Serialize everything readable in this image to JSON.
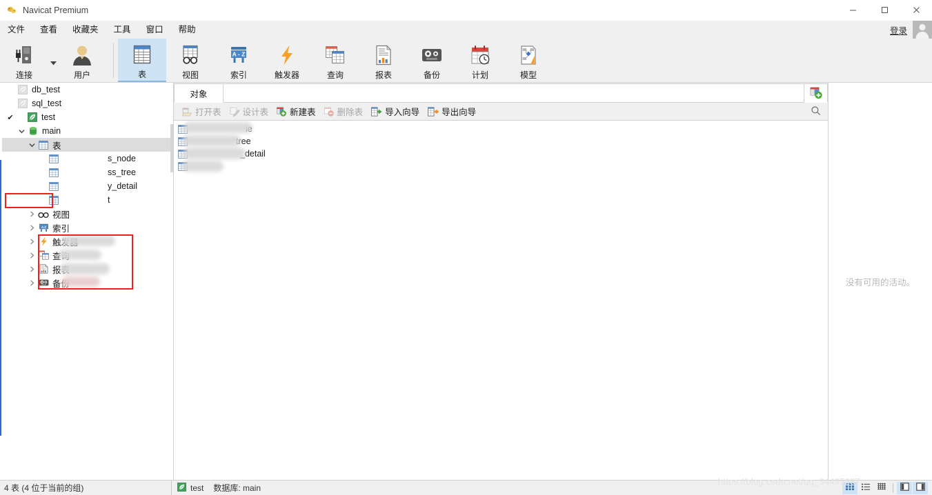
{
  "window": {
    "title": "Navicat Premium",
    "app_icon": "navicat-logo-icon",
    "minimize": "–",
    "maximize": "□",
    "close": "✕"
  },
  "menubar": {
    "items": [
      {
        "label": "文件",
        "name": "menu-file"
      },
      {
        "label": "查看",
        "name": "menu-view"
      },
      {
        "label": "收藏夹",
        "name": "menu-favorites"
      },
      {
        "label": "工具",
        "name": "menu-tools"
      },
      {
        "label": "窗口",
        "name": "menu-window"
      },
      {
        "label": "帮助",
        "name": "menu-help"
      }
    ],
    "login_label": "登录",
    "avatar_icon": "user-avatar-icon"
  },
  "ribbon": {
    "left": [
      {
        "label": "连接",
        "icon": "connection-icon",
        "active": false
      },
      {
        "label": "用户",
        "icon": "user-icon",
        "active": false
      }
    ],
    "right": [
      {
        "label": "表",
        "icon": "table-icon",
        "active": true
      },
      {
        "label": "视图",
        "icon": "view-glasses-icon",
        "active": false
      },
      {
        "label": "索引",
        "icon": "index-az-icon",
        "active": false
      },
      {
        "label": "触发器",
        "icon": "trigger-bolt-icon",
        "active": false
      },
      {
        "label": "查询",
        "icon": "query-icon",
        "active": false
      },
      {
        "label": "报表",
        "icon": "report-icon",
        "active": false
      },
      {
        "label": "备份",
        "icon": "backup-tape-icon",
        "active": false
      },
      {
        "label": "计划",
        "icon": "schedule-calendar-icon",
        "active": false
      },
      {
        "label": "模型",
        "icon": "model-diagram-icon",
        "active": false
      }
    ],
    "dropdown_caret": "▾"
  },
  "sidebar": {
    "items": [
      {
        "label": "db_test",
        "icon": "connection-leaf-icon",
        "indent": 0,
        "arrow": "",
        "checked": false,
        "selected": false,
        "state": "inactive"
      },
      {
        "label": "sql_test",
        "icon": "connection-leaf-icon",
        "indent": 0,
        "arrow": "",
        "checked": false,
        "selected": false,
        "state": "inactive"
      },
      {
        "label": "test",
        "icon": "connection-leaf-icon",
        "indent": 0,
        "arrow": "",
        "checked": true,
        "selected": false,
        "state": "active"
      },
      {
        "label": "main",
        "icon": "database-icon",
        "indent": 1,
        "arrow": "▾",
        "checked": false,
        "selected": false,
        "state": "active"
      },
      {
        "label": "表",
        "icon": "folder-table-icon",
        "indent": 2,
        "arrow": "▾",
        "checked": false,
        "selected": true,
        "state": "active"
      },
      {
        "label": "s_node",
        "icon": "table-item-icon",
        "indent": 3,
        "arrow": "",
        "checked": false,
        "selected": false,
        "state": "active",
        "redacted": true
      },
      {
        "label": "ss_tree",
        "icon": "table-item-icon",
        "indent": 3,
        "arrow": "",
        "checked": false,
        "selected": false,
        "state": "active",
        "redacted": true
      },
      {
        "label": "y_detail",
        "icon": "table-item-icon",
        "indent": 3,
        "arrow": "",
        "checked": false,
        "selected": false,
        "state": "active",
        "redacted": true
      },
      {
        "label": "t",
        "icon": "table-item-icon",
        "indent": 3,
        "arrow": "",
        "checked": false,
        "selected": false,
        "state": "active",
        "redacted": true
      },
      {
        "label": "视图",
        "icon": "view-glasses-icon",
        "indent": 2,
        "arrow": "›",
        "checked": false,
        "selected": false,
        "state": "active"
      },
      {
        "label": "索引",
        "icon": "index-az-icon",
        "indent": 2,
        "arrow": "›",
        "checked": false,
        "selected": false,
        "state": "active"
      },
      {
        "label": "触发器",
        "icon": "trigger-bolt-icon",
        "indent": 2,
        "arrow": "›",
        "checked": false,
        "selected": false,
        "state": "active"
      },
      {
        "label": "查询",
        "icon": "query-icon",
        "indent": 2,
        "arrow": "›",
        "checked": false,
        "selected": false,
        "state": "active"
      },
      {
        "label": "报表",
        "icon": "report-icon",
        "indent": 2,
        "arrow": "›",
        "checked": false,
        "selected": false,
        "state": "active"
      },
      {
        "label": "备份",
        "icon": "backup-tape-icon",
        "indent": 2,
        "arrow": "›",
        "checked": false,
        "selected": false,
        "state": "active"
      }
    ]
  },
  "main": {
    "tab_label": "对象",
    "add_tab_icon": "new-tab-icon",
    "search_icon": "search-icon",
    "toolbar": [
      {
        "label": "打开表",
        "icon": "open-table-icon",
        "disabled": true
      },
      {
        "label": "设计表",
        "icon": "design-table-icon",
        "disabled": true
      },
      {
        "label": "新建表",
        "icon": "new-table-icon",
        "disabled": false
      },
      {
        "label": "删除表",
        "icon": "delete-table-icon",
        "disabled": true
      },
      {
        "label": "导入向导",
        "icon": "import-wizard-icon",
        "disabled": false
      },
      {
        "label": "导出向导",
        "icon": "export-wizard-icon",
        "disabled": false
      }
    ],
    "rows": [
      {
        "label": "ie",
        "icon": "table-item-icon",
        "redacted": true
      },
      {
        "label": "tree",
        "icon": "table-item-icon",
        "redacted": true
      },
      {
        "label": "_detail",
        "icon": "table-item-icon",
        "redacted": true
      },
      {
        "label": "",
        "icon": "table-item-icon",
        "redacted": true
      }
    ]
  },
  "right_panel": {
    "empty_message": "没有可用的活动。"
  },
  "statusbar": {
    "left_text": "4 表 (4 位于当前的组)",
    "connection_icon": "connection-leaf-icon",
    "connection_name": "test",
    "database_text": "数据库: main",
    "view_buttons": [
      {
        "name": "grid-view-button",
        "icon": "grid-view-icon",
        "active": true
      },
      {
        "name": "list-view-button",
        "icon": "list-view-icon",
        "active": false
      },
      {
        "name": "detail-view-button",
        "icon": "detail-view-icon",
        "active": false
      },
      {
        "name": "left-pane-toggle-button",
        "icon": "left-pane-icon",
        "active": true
      },
      {
        "name": "right-pane-toggle-button",
        "icon": "right-pane-icon",
        "active": true
      }
    ]
  },
  "watermark": {
    "text": "https://blog.csdn.net/qq_34495287"
  },
  "colors": {
    "accent_blue": "#2a6fc4",
    "active_tab_bg": "#cfe3f7",
    "annotation_red": "#ef2020",
    "connection_green": "#3fa45b",
    "chrome_gray": "#f0f0f0"
  }
}
